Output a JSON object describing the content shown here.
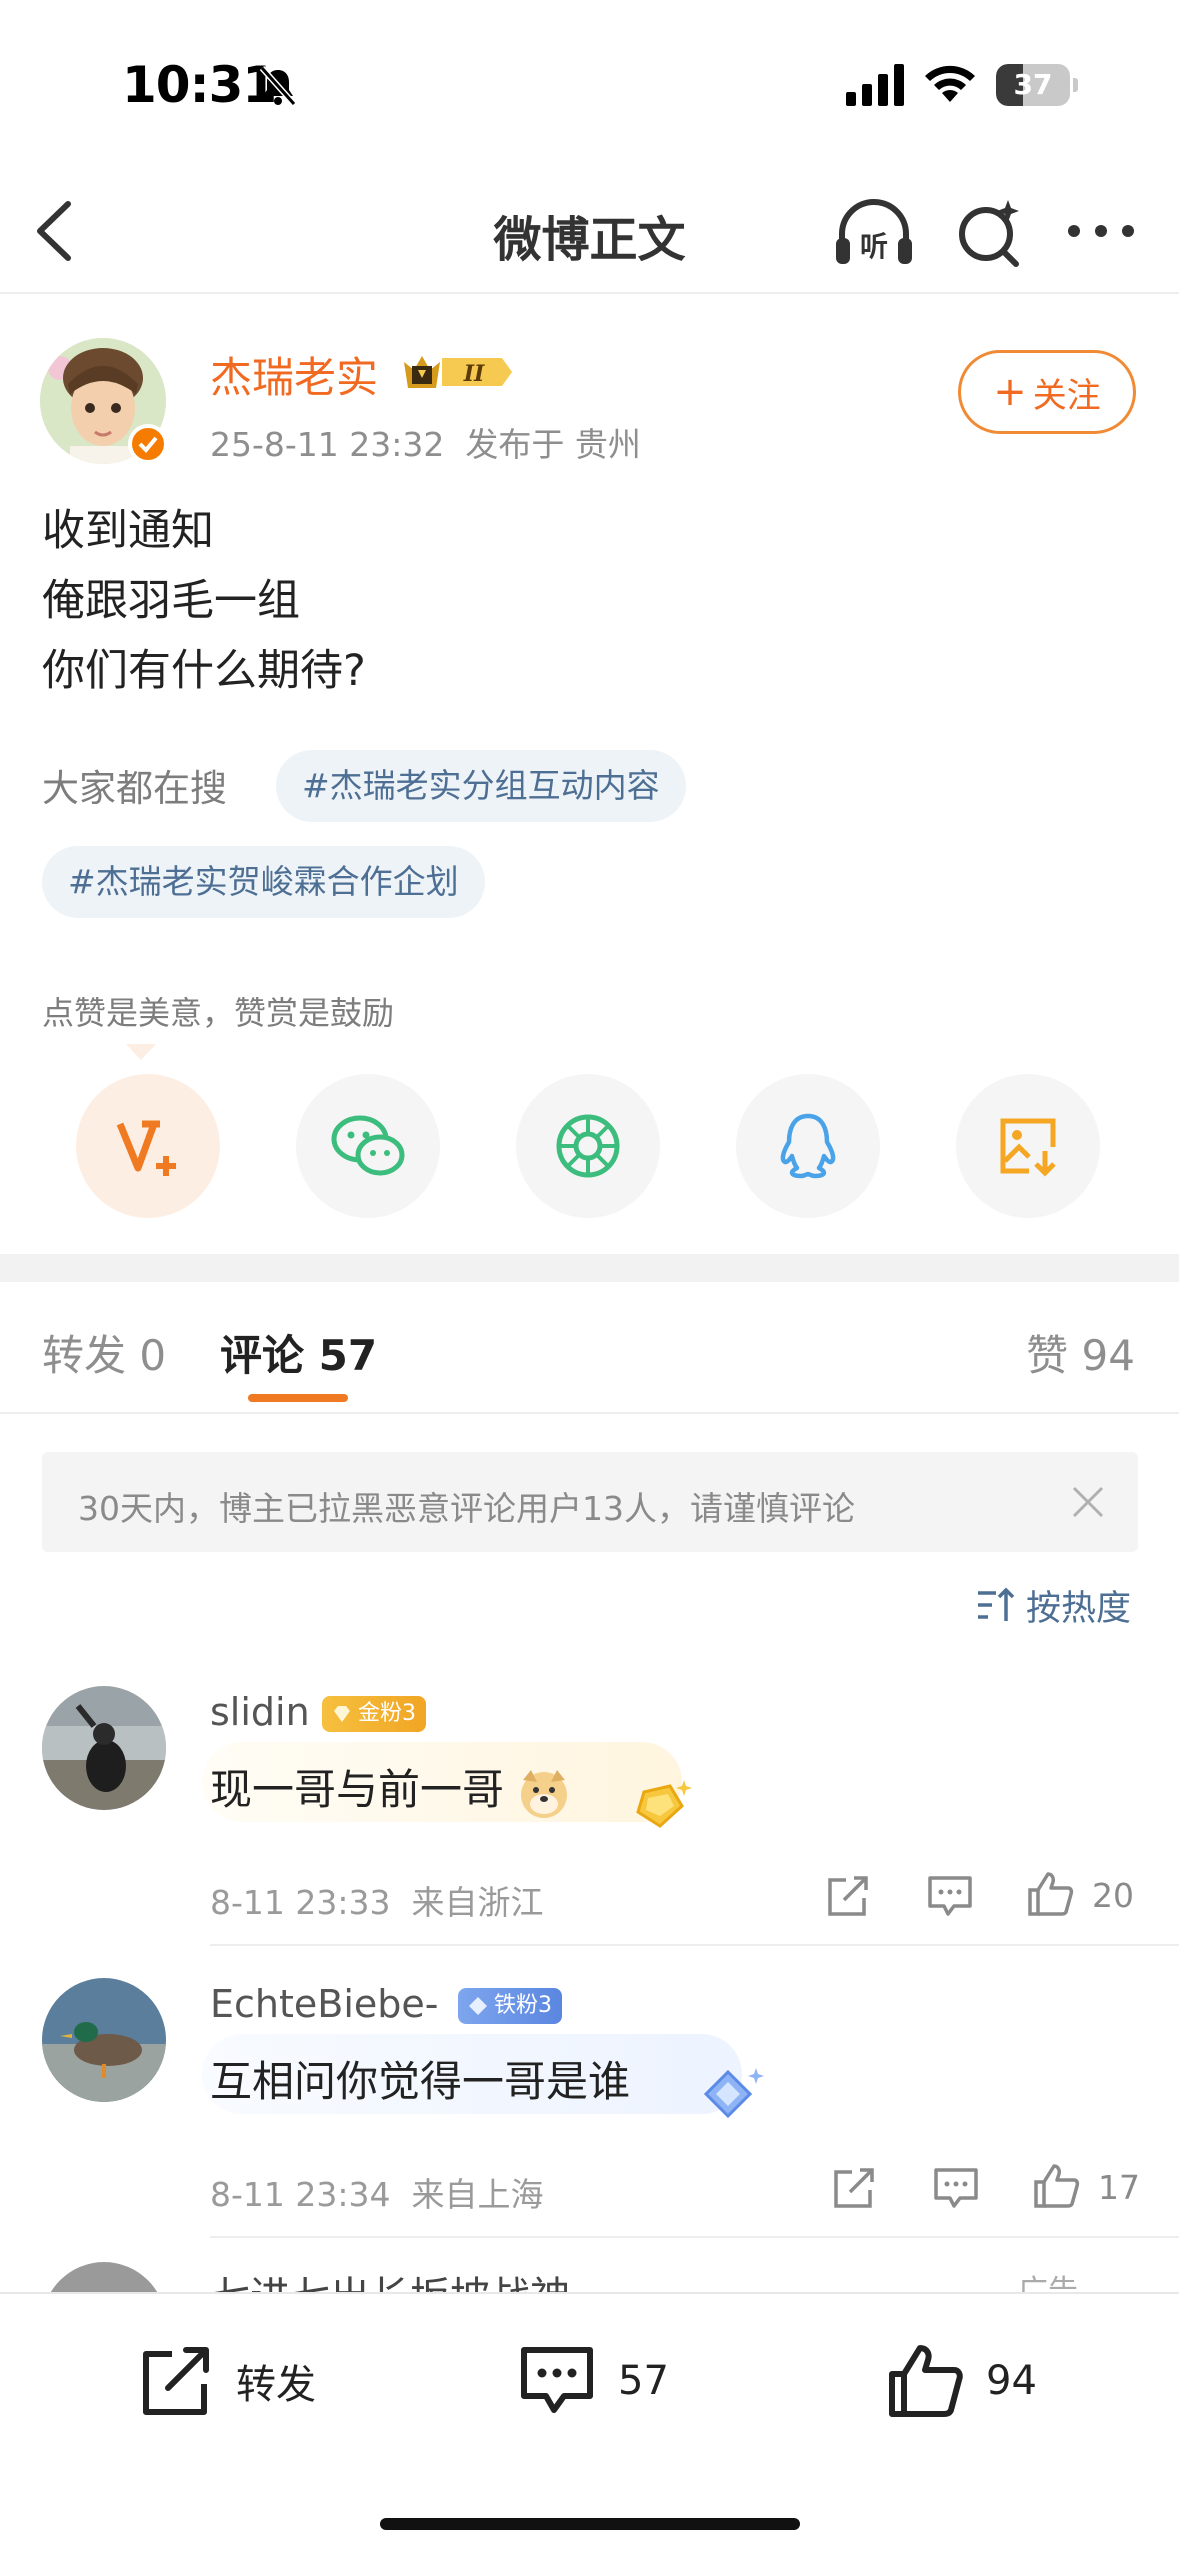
{
  "status_bar": {
    "time": "10:31",
    "battery": "37",
    "battery_level": 0.37
  },
  "nav": {
    "title": "微博正文",
    "listen_label": "听"
  },
  "post": {
    "author": "杰瑞老实",
    "level_badge": "II",
    "timestamp": "25-8-11 23:32",
    "location": "发布于 贵州",
    "follow_label": "关注",
    "lines": [
      "收到通知",
      "俺跟羽毛一组",
      "你们有什么期待?"
    ],
    "search_label": "大家都在搜",
    "topics": [
      "#杰瑞老实分组互动内容",
      "#杰瑞老实贺峻霖合作企划"
    ],
    "reward_label": "点赞是美意，赞赏是鼓励"
  },
  "share_icons": [
    "reward-v-plus-icon",
    "wechat-icon",
    "moments-icon",
    "qq-icon",
    "save-image-icon"
  ],
  "tabs": {
    "repost_label": "转发",
    "repost_count": "0",
    "comments_label": "评论",
    "comments_count": "57",
    "likes_label": "赞",
    "likes_count": "94"
  },
  "notice": {
    "text": "30天内，博主已拉黑恶意评论用户13人，请谨慎评论"
  },
  "sort": {
    "label": "按热度"
  },
  "comments": [
    {
      "name": "slidin",
      "badge": "金粉3",
      "text": "现一哥与前一哥",
      "time": "8-11 23:33",
      "location": "来自浙江",
      "likes": "20"
    },
    {
      "name": "EchteBiebe-",
      "badge": "铁粉3",
      "text": "互相问你觉得一哥是谁",
      "time": "8-11 23:34",
      "location": "来自上海",
      "likes": "17"
    }
  ],
  "partial_row": {
    "text": "七进七出长坂坡战神",
    "ad_label": "广告"
  },
  "bottom_bar": {
    "repost_label": "转发",
    "comment_count": "57",
    "like_count": "94"
  },
  "colors": {
    "accent": "#f06a22",
    "link": "#4e6f94",
    "tab_indicator": "#f07a22"
  }
}
